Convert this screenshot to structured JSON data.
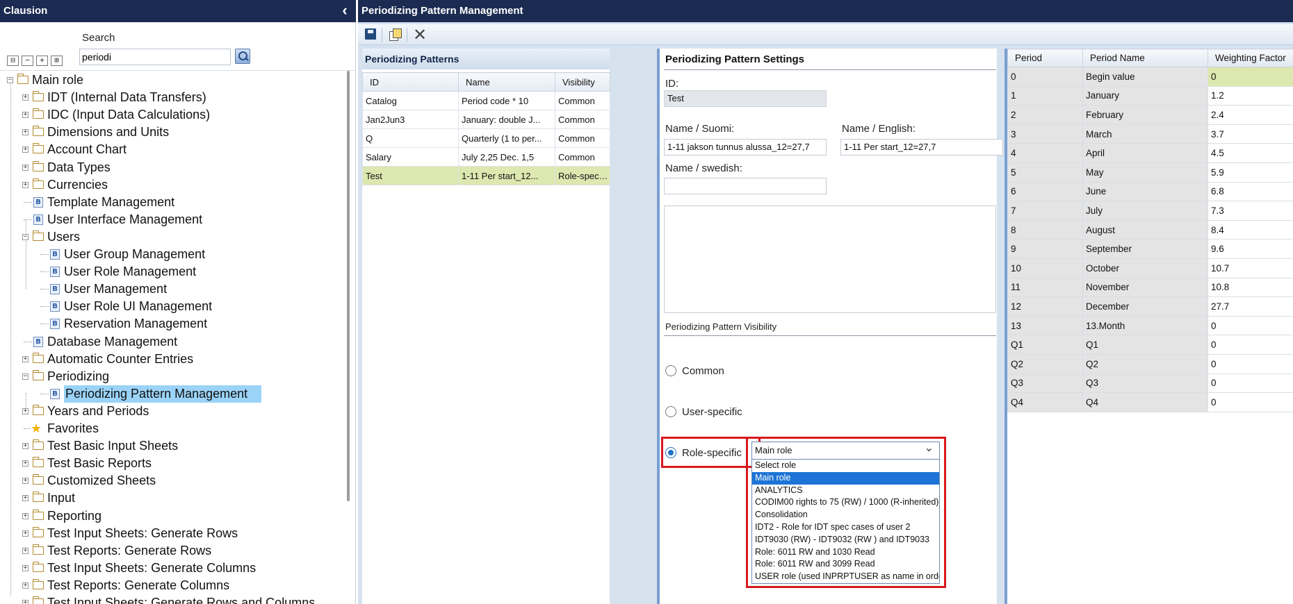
{
  "app": {
    "title": "Clausion"
  },
  "search": {
    "label": "Search",
    "value": "periodi"
  },
  "tree": [
    {
      "label": "Main role",
      "type": "folder",
      "level": 0,
      "expanded": true
    },
    {
      "label": "IDT (Internal Data Transfers)",
      "type": "folder",
      "level": 1
    },
    {
      "label": "IDC (Input Data Calculations)",
      "type": "folder",
      "level": 1
    },
    {
      "label": "Dimensions and Units",
      "type": "folder",
      "level": 1
    },
    {
      "label": "Account Chart",
      "type": "folder",
      "level": 1
    },
    {
      "label": "Data Types",
      "type": "folder",
      "level": 1
    },
    {
      "label": "Currencies",
      "type": "folder",
      "level": 1
    },
    {
      "label": "Template Management",
      "type": "item",
      "level": 1
    },
    {
      "label": "User Interface Management",
      "type": "item",
      "level": 1
    },
    {
      "label": "Users",
      "type": "folder",
      "level": 1,
      "expanded": true
    },
    {
      "label": "User Group Management",
      "type": "item",
      "level": 2
    },
    {
      "label": "User Role Management",
      "type": "item",
      "level": 2
    },
    {
      "label": "User Management",
      "type": "item",
      "level": 2
    },
    {
      "label": "User Role UI Management",
      "type": "item",
      "level": 2
    },
    {
      "label": "Reservation Management",
      "type": "item",
      "level": 2
    },
    {
      "label": "Database Management",
      "type": "item",
      "level": 1
    },
    {
      "label": "Automatic Counter Entries",
      "type": "folder",
      "level": 1
    },
    {
      "label": "Periodizing",
      "type": "folder",
      "level": 1,
      "expanded": true
    },
    {
      "label": "Periodizing Pattern Management",
      "type": "item",
      "level": 2,
      "selected": true
    },
    {
      "label": "Years and Periods",
      "type": "folder",
      "level": 1
    },
    {
      "label": "Favorites",
      "type": "star",
      "level": 1
    },
    {
      "label": "Test Basic Input Sheets",
      "type": "folder",
      "level": 1
    },
    {
      "label": "Test Basic Reports",
      "type": "folder",
      "level": 1
    },
    {
      "label": "Customized Sheets",
      "type": "folder",
      "level": 1
    },
    {
      "label": "Input",
      "type": "folder",
      "level": 1
    },
    {
      "label": "Reporting",
      "type": "folder",
      "level": 1
    },
    {
      "label": "Test Input Sheets: Generate Rows",
      "type": "folder",
      "level": 1
    },
    {
      "label": "Test Reports: Generate Rows",
      "type": "folder",
      "level": 1
    },
    {
      "label": "Test Input Sheets: Generate Columns",
      "type": "folder",
      "level": 1
    },
    {
      "label": "Test Reports: Generate Columns",
      "type": "folder",
      "level": 1
    },
    {
      "label": "Test Input Sheets: Generate Rows and Columns",
      "type": "folder",
      "level": 1
    }
  ],
  "main": {
    "title": "Periodizing Pattern Management"
  },
  "patterns": {
    "title": "Periodizing Patterns",
    "columns": [
      "ID",
      "Name",
      "Visibility"
    ],
    "rows": [
      [
        "Catalog",
        "Period code * 10",
        "Common"
      ],
      [
        "Jan2Jun3",
        "January: double J...",
        "Common"
      ],
      [
        "Q",
        "Quarterly (1 to per...",
        "Common"
      ],
      [
        "Salary",
        "July 2,25 Dec. 1,5",
        "Common"
      ],
      [
        "Test",
        "1-11 Per start_12...",
        "Role-specific"
      ]
    ],
    "selected_index": 4
  },
  "settings": {
    "title": "Periodizing Pattern Settings",
    "id_label": "ID:",
    "id_value": "Test",
    "name_fi_label": "Name / Suomi:",
    "name_fi_value": "1-11 jakson tunnus alussa_12=27,7",
    "name_en_label": "Name / English:",
    "name_en_value": "1-11 Per start_12=27,7",
    "name_sv_label": "Name / swedish:",
    "name_sv_value": "",
    "visibility_title": "Periodizing Pattern Visibility",
    "visibility_options": [
      "Common",
      "User-specific",
      "Role-specific"
    ],
    "visibility_selected": "Role-specific",
    "role_dropdown": {
      "selected": "Main role",
      "options": [
        "Select role",
        "Main role",
        "ANALYTICS",
        "CODIM00 rights to 75 (RW) / 1000 (R-inherited)",
        "Consolidation",
        "IDT2 - Role for IDT spec cases of user 2",
        "IDT9030 (RW) - IDT9032  (RW ) and IDT9033",
        "Role: 6011 RW and 1030 Read",
        "Role: 6011 RW and 3099 Read",
        "USER role (used INPRPTUSER as name in order"
      ],
      "highlighted_index": 1
    }
  },
  "periods": {
    "columns": [
      "Period",
      "Period Name",
      "Weighting Factor"
    ],
    "rows": [
      [
        "0",
        "Begin value",
        "0"
      ],
      [
        "1",
        "January",
        "1.2"
      ],
      [
        "2",
        "February",
        "2.4"
      ],
      [
        "3",
        "March",
        "3.7"
      ],
      [
        "4",
        "April",
        "4.5"
      ],
      [
        "5",
        "May",
        "5.9"
      ],
      [
        "6",
        "June",
        "6.8"
      ],
      [
        "7",
        "July",
        "7.3"
      ],
      [
        "8",
        "August",
        "8.4"
      ],
      [
        "9",
        "September",
        "9.6"
      ],
      [
        "10",
        "October",
        "10.7"
      ],
      [
        "11",
        "November",
        "10.8"
      ],
      [
        "12",
        "December",
        "27.7"
      ],
      [
        "13",
        "13.Month",
        "0"
      ],
      [
        "Q1",
        "Q1",
        "0"
      ],
      [
        "Q2",
        "Q2",
        "0"
      ],
      [
        "Q3",
        "Q3",
        "0"
      ],
      [
        "Q4",
        "Q4",
        "0"
      ]
    ]
  },
  "colors": {
    "title_bar": "#1b2b52",
    "selected_row": "#dde7b0",
    "tree_selection": "#9ad3f7",
    "highlight_box": "#d7191e",
    "dropdown_highlight": "#1e74d6"
  }
}
